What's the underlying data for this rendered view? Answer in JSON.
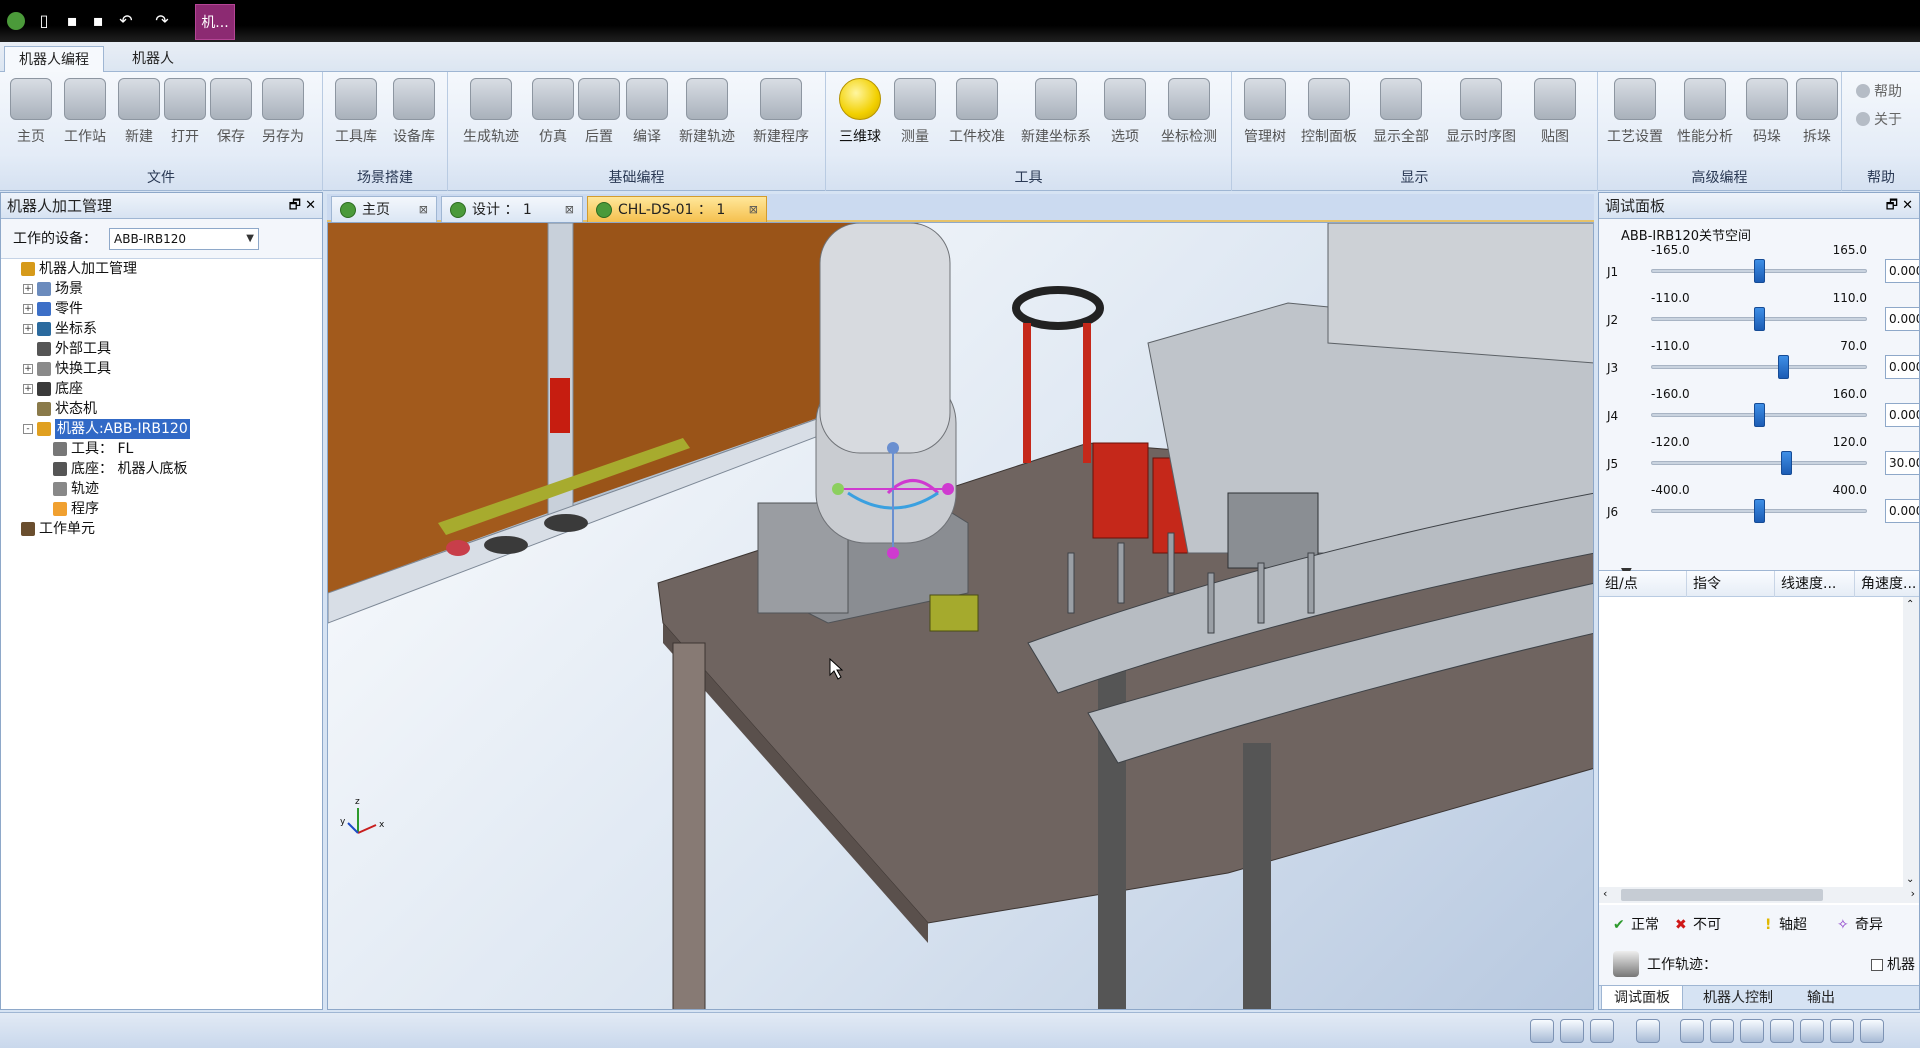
{
  "titlebar": {
    "doc_tab": "机..."
  },
  "ribbon_tabs": [
    "机器人编程",
    "机器人"
  ],
  "ribbon": {
    "groups": [
      {
        "label": "文件",
        "buttons": [
          "主页",
          "工作站",
          "新建",
          "打开",
          "保存",
          "另存为"
        ]
      },
      {
        "label": "场景搭建",
        "buttons": [
          "工具库",
          "设备库"
        ]
      },
      {
        "label": "基础编程",
        "buttons": [
          "生成轨迹",
          "仿真",
          "后置",
          "编译",
          "新建轨迹",
          "新建程序"
        ]
      },
      {
        "label": "工具",
        "buttons": [
          "三维球",
          "测量",
          "工件校准",
          "新建坐标系",
          "选项",
          "坐标检测"
        ]
      },
      {
        "label": "显示",
        "buttons": [
          "管理树",
          "控制面板",
          "显示全部",
          "显示时序图",
          "贴图"
        ]
      },
      {
        "label": "高级编程",
        "buttons": [
          "工艺设置",
          "性能分析",
          "码垛",
          "拆垛"
        ]
      },
      {
        "label": "帮助",
        "buttons": [
          "帮助",
          "关于"
        ]
      }
    ]
  },
  "left_panel": {
    "title": "机器人加工管理",
    "device_label": "工作的设备：",
    "device_value": "ABB-IRB120",
    "tree": [
      {
        "label": "机器人加工管理",
        "depth": 0,
        "expander": ""
      },
      {
        "label": "场景",
        "depth": 1,
        "expander": "+"
      },
      {
        "label": "零件",
        "depth": 1,
        "expander": "+"
      },
      {
        "label": "坐标系",
        "depth": 1,
        "expander": "+"
      },
      {
        "label": "外部工具",
        "depth": 1,
        "expander": ""
      },
      {
        "label": "快换工具",
        "depth": 1,
        "expander": "+"
      },
      {
        "label": "底座",
        "depth": 1,
        "expander": "+"
      },
      {
        "label": "状态机",
        "depth": 1,
        "expander": ""
      },
      {
        "label": "机器人:ABB-IRB120",
        "depth": 1,
        "expander": "-",
        "selected": true
      },
      {
        "label": "工具： FL",
        "depth": 2,
        "expander": ""
      },
      {
        "label": "底座： 机器人底板",
        "depth": 2,
        "expander": ""
      },
      {
        "label": "轨迹",
        "depth": 2,
        "expander": ""
      },
      {
        "label": "程序",
        "depth": 2,
        "expander": ""
      },
      {
        "label": "工作单元",
        "depth": 0,
        "expander": ""
      }
    ]
  },
  "doc_tabs": [
    {
      "label": "主页",
      "active": false
    },
    {
      "label": "设计 ： 1",
      "active": false
    },
    {
      "label": "CHL-DS-01 ： 1",
      "active": true
    }
  ],
  "viewport": {
    "axis_labels": {
      "x": "x",
      "y": "y",
      "z": "z"
    }
  },
  "right_panel": {
    "title": "调试面板",
    "joint_title": "ABB-IRB120关节空间",
    "joints": [
      {
        "name": "J1",
        "min": "-165.0",
        "max": "165.0",
        "value": "0.000",
        "pos": 0.5
      },
      {
        "name": "J2",
        "min": "-110.0",
        "max": "110.0",
        "value": "0.000",
        "pos": 0.5
      },
      {
        "name": "J3",
        "min": "-110.0",
        "max": "70.0",
        "value": "0.000",
        "pos": 0.611
      },
      {
        "name": "J4",
        "min": "-160.0",
        "max": "160.0",
        "value": "0.000",
        "pos": 0.5
      },
      {
        "name": "J5",
        "min": "-120.0",
        "max": "120.0",
        "value": "30.000",
        "pos": 0.625
      },
      {
        "name": "J6",
        "min": "-400.0",
        "max": "400.0",
        "value": "0.000",
        "pos": 0.5
      }
    ],
    "table_headers": [
      "组/点",
      "指令",
      "线速度...",
      "角速度..."
    ],
    "legend": {
      "normal": "正常",
      "no": "不可",
      "axis_over": "轴超",
      "singular": "奇异"
    },
    "work_track_label": "工作轨迹：",
    "robot_checkbox_label": "机器",
    "bottom_tabs": [
      "调试面板",
      "机器人控制",
      "输出"
    ]
  },
  "colors": {
    "accent": "#3169c6",
    "ribbon_bg": "#e4ecf7",
    "active_tab": "#f5c04e"
  }
}
